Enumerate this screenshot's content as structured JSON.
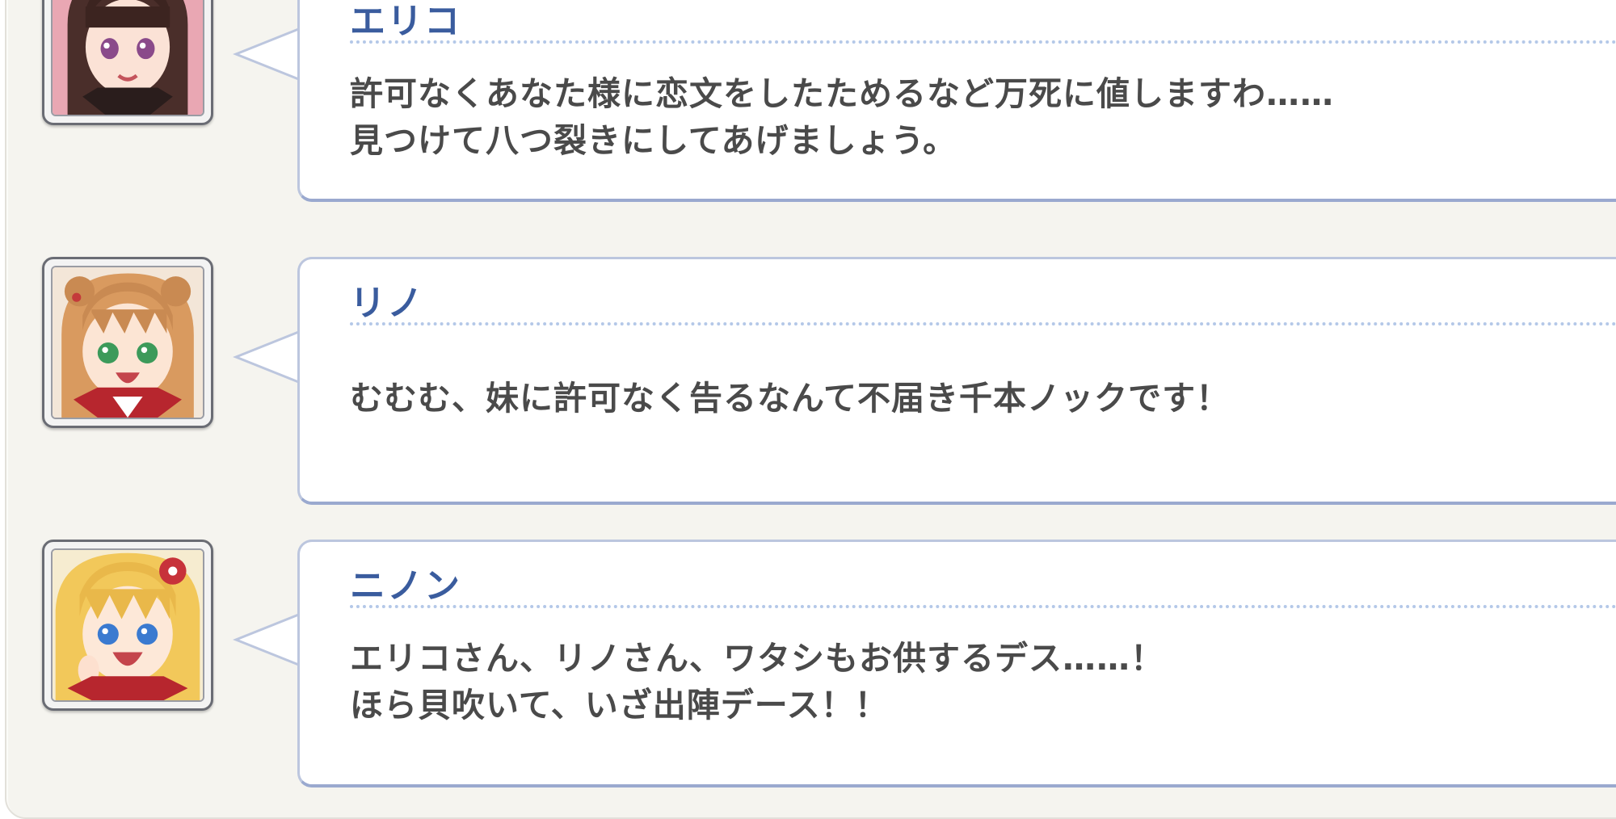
{
  "chat_log": {
    "messages": [
      {
        "speaker": "エリコ",
        "avatar": "eriko-portrait",
        "lines": [
          "許可なくあなた様に恋文をしたためるなど万死に値しますわ……",
          "見つけて八つ裂きにしてあげましょう。"
        ]
      },
      {
        "speaker": "リノ",
        "avatar": "rino-portrait",
        "lines": [
          "むむむ、妹に許可なく告るなんて不届き千本ノックです！"
        ]
      },
      {
        "speaker": "ニノン",
        "avatar": "ninon-portrait",
        "lines": [
          "エリコさん、リノさん、ワタシもお供するデス……！",
          "ほら貝吹いて、いざ出陣デース！！"
        ]
      }
    ]
  },
  "colors": {
    "speaker_name": "#3a5c9e",
    "message_text": "#4a4a4a",
    "bubble_border": "#bcc6de",
    "name_rule": "#b4c8e8",
    "panel_background": "#f5f4ef"
  }
}
